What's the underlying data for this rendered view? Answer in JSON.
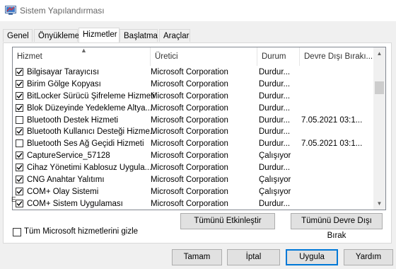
{
  "window": {
    "title": "Sistem Yapılandırması",
    "icon": "msconfig-icon"
  },
  "tabs": [
    {
      "label": "Genel",
      "active": false
    },
    {
      "label": "Önyükleme",
      "active": false
    },
    {
      "label": "Hizmetler",
      "active": true
    },
    {
      "label": "Başlatma",
      "active": false
    },
    {
      "label": "Araçlar",
      "active": false
    }
  ],
  "columns": {
    "name": "Hizmet",
    "manufacturer": "Üretici",
    "status": "Durum",
    "disabled_date": "Devre Dışı Bırakı..."
  },
  "services": [
    {
      "checked": true,
      "name": "Bilgisayar Tarayıcısı",
      "manufacturer": "Microsoft Corporation",
      "status": "Durdur...",
      "date": ""
    },
    {
      "checked": true,
      "name": "Birim Gölge Kopyası",
      "manufacturer": "Microsoft Corporation",
      "status": "Durdur...",
      "date": ""
    },
    {
      "checked": true,
      "name": "BitLocker Sürücü Şifreleme Hizmeti",
      "manufacturer": "Microsoft Corporation",
      "status": "Durdur...",
      "date": ""
    },
    {
      "checked": true,
      "name": "Blok Düzeyinde Yedekleme Altya...",
      "manufacturer": "Microsoft Corporation",
      "status": "Durdur...",
      "date": ""
    },
    {
      "checked": false,
      "name": "Bluetooth Destek Hizmeti",
      "manufacturer": "Microsoft Corporation",
      "status": "Durdur...",
      "date": "7.05.2021 03:1..."
    },
    {
      "checked": true,
      "name": "Bluetooth Kullanıcı Desteği Hizme...",
      "manufacturer": "Microsoft Corporation",
      "status": "Durdur...",
      "date": ""
    },
    {
      "checked": false,
      "name": "Bluetooth Ses Ağ Geçidi Hizmeti",
      "manufacturer": "Microsoft Corporation",
      "status": "Durdur...",
      "date": "7.05.2021 03:1..."
    },
    {
      "checked": true,
      "name": "CaptureService_57128",
      "manufacturer": "Microsoft Corporation",
      "status": "Çalışıyor",
      "date": ""
    },
    {
      "checked": true,
      "name": "Cihaz Yönetimi Kablosuz Uygula...",
      "manufacturer": "Microsoft Corporation",
      "status": "Durdur...",
      "date": ""
    },
    {
      "checked": true,
      "name": "CNG Anahtar Yalıtımı",
      "manufacturer": "Microsoft Corporation",
      "status": "Çalışıyor",
      "date": ""
    },
    {
      "checked": true,
      "name": "COM+ Olay Sistemi",
      "manufacturer": "Microsoft Corporation",
      "status": "Çalışıyor",
      "date": ""
    },
    {
      "checked": true,
      "name": "COM+ Sistem Uygulaması",
      "manufacturer": "Microsoft Corporation",
      "status": "Durdur...",
      "date": ""
    }
  ],
  "buttons": {
    "enable_all": "Tümünü Etkinleştir",
    "disable_all": "Tümünü Devre Dışı Bırak",
    "ok": "Tamam",
    "cancel": "İptal",
    "apply": "Uygula",
    "help": "Yardım"
  },
  "hide_microsoft": {
    "label": "Tüm Microsoft hizmetlerini gizle",
    "checked": false
  },
  "stray_glyph": "E",
  "colors": {
    "accent": "#0078d7",
    "checkbox_border": "#333333"
  }
}
